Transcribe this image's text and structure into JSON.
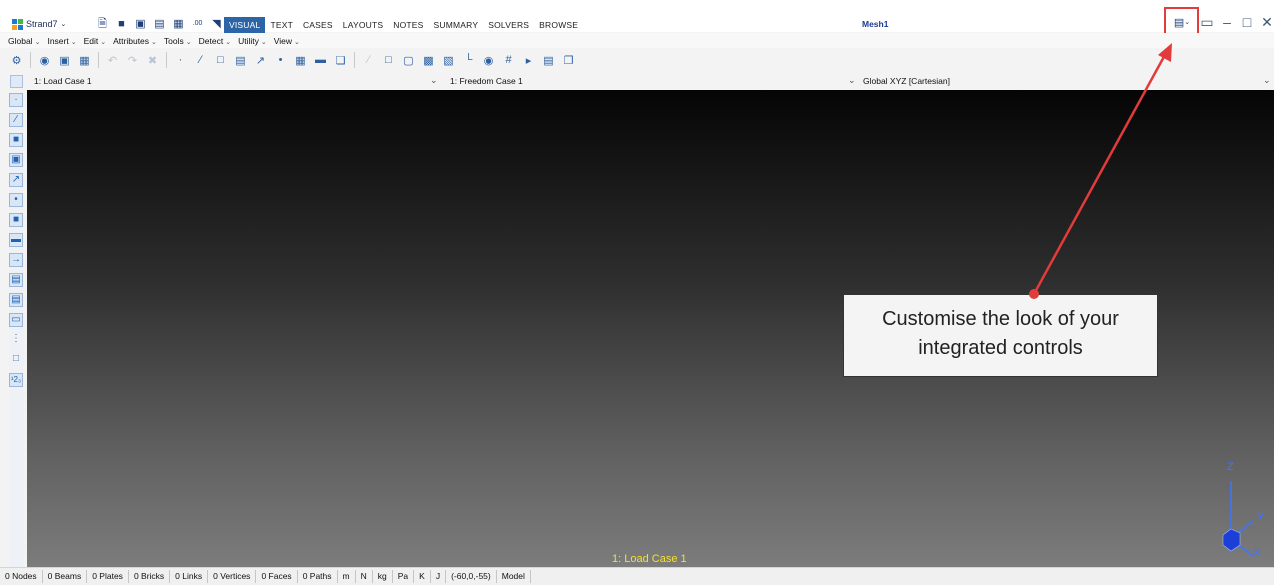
{
  "app": {
    "name": "Strand7",
    "document_title": "Mesh1"
  },
  "tabs": [
    {
      "label": "VISUAL",
      "active": true
    },
    {
      "label": "TEXT",
      "active": false
    },
    {
      "label": "CASES",
      "active": false
    },
    {
      "label": "LAYOUTS",
      "active": false
    },
    {
      "label": "NOTES",
      "active": false
    },
    {
      "label": "SUMMARY",
      "active": false
    },
    {
      "label": "SOLVERS",
      "active": false
    },
    {
      "label": "BROWSE",
      "active": false
    }
  ],
  "menus": [
    "Global",
    "Insert",
    "Edit",
    "Attributes",
    "Tools",
    "Detect",
    "Utility",
    "View"
  ],
  "case_row": {
    "load_case": "1: Load Case 1",
    "freedom_case": "1: Freedom Case 1",
    "coordinate_system": "Global XYZ [Cartesian]"
  },
  "viewport": {
    "case_label": "1: Load Case 1",
    "axis_x": "X",
    "axis_y": "Y",
    "axis_z": "Z"
  },
  "callout": {
    "line1": "Customise the look of your",
    "line2": "integrated controls"
  },
  "statusbar": [
    "0 Nodes",
    "0 Beams",
    "0 Plates",
    "0 Bricks",
    "0 Links",
    "0 Vertices",
    "0 Faces",
    "0 Paths",
    "m",
    "N",
    "kg",
    "Pa",
    "K",
    "J",
    "(-60,0,-55)",
    "Model"
  ],
  "colors": {
    "accent": "#2b65a7",
    "highlight": "#e23b3b",
    "viewport_label": "#f3e12b",
    "axes": "#3e74ff"
  }
}
